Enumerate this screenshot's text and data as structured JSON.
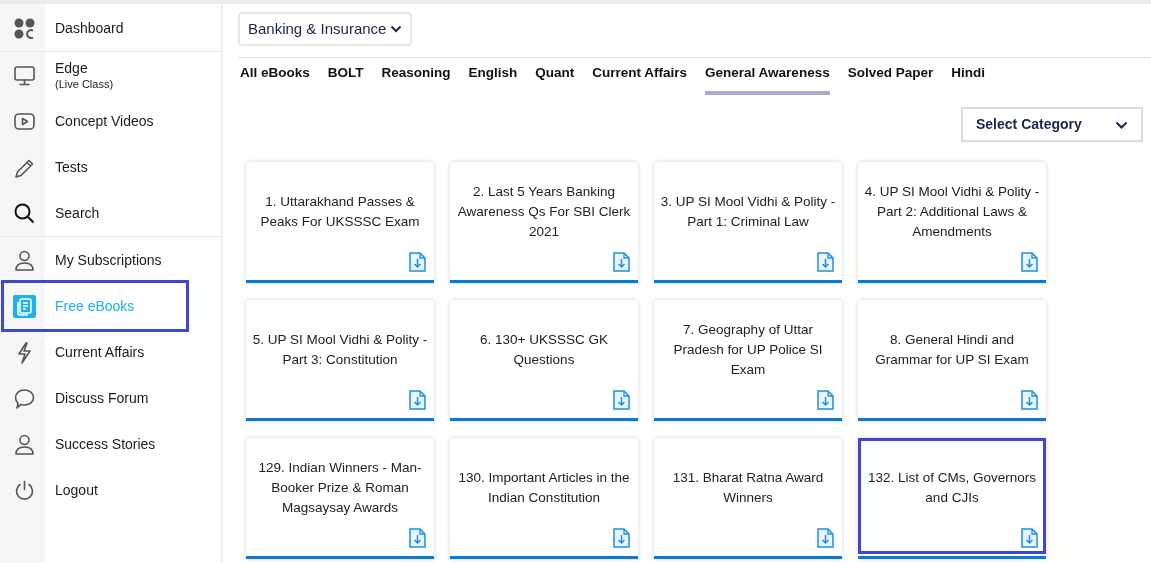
{
  "sidebar": {
    "groups": [
      {
        "items": [
          {
            "kind": "dashboard",
            "label": "Dashboard",
            "selected": false,
            "highlighted": false
          }
        ]
      },
      {
        "items": [
          {
            "kind": "monitor",
            "label": "Edge",
            "sublabel": "(Live Class)",
            "selected": false,
            "highlighted": false
          },
          {
            "kind": "video",
            "label": "Concept Videos",
            "selected": false,
            "highlighted": false
          },
          {
            "kind": "pencil",
            "label": "Tests",
            "selected": false,
            "highlighted": false
          },
          {
            "kind": "search",
            "label": "Search",
            "selected": false,
            "highlighted": false
          }
        ]
      },
      {
        "items": [
          {
            "kind": "user",
            "label": "My Subscriptions",
            "selected": false,
            "highlighted": false
          },
          {
            "kind": "ebook",
            "label": "Free eBooks",
            "selected": true,
            "highlighted": true
          },
          {
            "kind": "bolt",
            "label": "Current Affairs",
            "selected": false,
            "highlighted": false
          },
          {
            "kind": "chat",
            "label": "Discuss Forum",
            "selected": false,
            "highlighted": false
          },
          {
            "kind": "user",
            "label": "Success Stories",
            "selected": false,
            "highlighted": false
          },
          {
            "kind": "power",
            "label": "Logout",
            "selected": false,
            "highlighted": false
          }
        ]
      }
    ]
  },
  "exam_dropdown": {
    "value": "Banking & Insurance"
  },
  "tabs": [
    {
      "label": "All eBooks",
      "selected": false
    },
    {
      "label": "BOLT",
      "selected": false
    },
    {
      "label": "Reasoning",
      "selected": false
    },
    {
      "label": "English",
      "selected": false
    },
    {
      "label": "Quant",
      "selected": false
    },
    {
      "label": "Current Affairs",
      "selected": false
    },
    {
      "label": "General Awareness",
      "selected": true
    },
    {
      "label": "Solved Paper",
      "selected": false
    },
    {
      "label": "Hindi",
      "selected": false
    }
  ],
  "category_select": {
    "placeholder": "Select Category"
  },
  "ebooks": [
    {
      "title": "1.  Uttarakhand Passes & Peaks For UKSSSC Exam",
      "highlighted": false
    },
    {
      "title": "2.  Last 5 Years Banking Awareness Qs For SBI Clerk 2021",
      "highlighted": false
    },
    {
      "title": "3.  UP SI Mool Vidhi & Polity - Part 1: Criminal Law",
      "highlighted": false
    },
    {
      "title": "4.  UP SI Mool Vidhi & Polity - Part 2: Additional Laws & Amendments",
      "highlighted": false
    },
    {
      "title": "5.  UP SI Mool Vidhi & Polity - Part 3: Constitution",
      "highlighted": false
    },
    {
      "title": "6.  130+ UKSSSC GK Questions",
      "highlighted": false
    },
    {
      "title": "7.  Geography of Uttar Pradesh for UP Police SI Exam",
      "highlighted": false
    },
    {
      "title": "8.  General Hindi and Grammar for UP SI Exam",
      "highlighted": false
    },
    {
      "title": "129.  Indian Winners - Man-Booker Prize & Roman Magsaysay Awards",
      "highlighted": false
    },
    {
      "title": "130.  Important Articles in the Indian Constitution",
      "highlighted": false
    },
    {
      "title": "131.  Bharat Ratna Award Winners",
      "highlighted": false
    },
    {
      "title": "132.  List of CMs, Governors and CJIs",
      "highlighted": true
    }
  ]
}
